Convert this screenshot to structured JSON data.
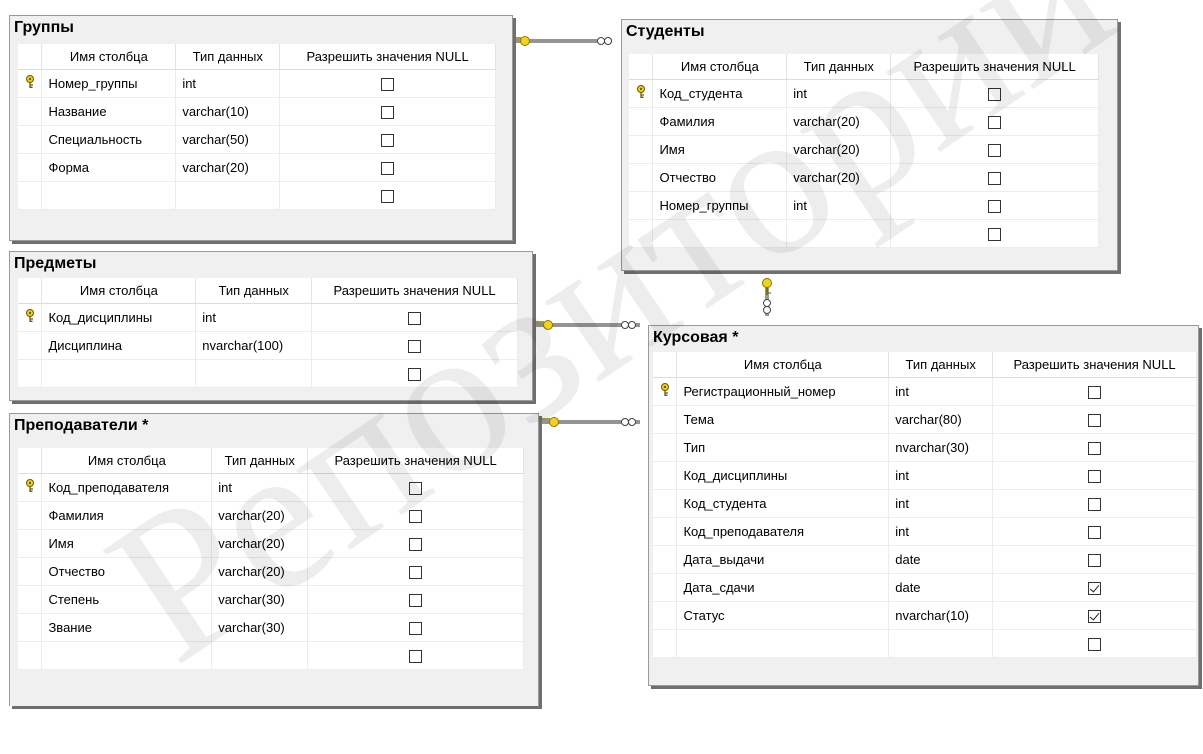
{
  "header_labels": {
    "column_name": "Имя столбца",
    "data_type": "Тип данных",
    "allow_null": "Разрешить значения NULL"
  },
  "tables": [
    {
      "title": "Группы",
      "rows": [
        {
          "pk": true,
          "name": "Номер_группы",
          "type": "int",
          "null": false
        },
        {
          "pk": false,
          "name": "Название",
          "type": "varchar(10)",
          "null": false
        },
        {
          "pk": false,
          "name": "Специальность",
          "type": "varchar(50)",
          "null": false
        },
        {
          "pk": false,
          "name": "Форма",
          "type": "varchar(20)",
          "null": false
        }
      ]
    },
    {
      "title": "Студенты",
      "rows": [
        {
          "pk": true,
          "name": "Код_студента",
          "type": "int",
          "null": false
        },
        {
          "pk": false,
          "name": "Фамилия",
          "type": "varchar(20)",
          "null": false
        },
        {
          "pk": false,
          "name": "Имя",
          "type": "varchar(20)",
          "null": false
        },
        {
          "pk": false,
          "name": "Отчество",
          "type": "varchar(20)",
          "null": false
        },
        {
          "pk": false,
          "name": "Номер_группы",
          "type": "int",
          "null": false
        }
      ]
    },
    {
      "title": "Предметы",
      "rows": [
        {
          "pk": true,
          "name": "Код_дисциплины",
          "type": "int",
          "null": false
        },
        {
          "pk": false,
          "name": "Дисциплина",
          "type": "nvarchar(100)",
          "null": false
        }
      ]
    },
    {
      "title": "Курсовая *",
      "rows": [
        {
          "pk": true,
          "name": "Регистрационный_номер",
          "type": "int",
          "null": false
        },
        {
          "pk": false,
          "name": "Тема",
          "type": "varchar(80)",
          "null": false
        },
        {
          "pk": false,
          "name": "Тип",
          "type": "nvarchar(30)",
          "null": false
        },
        {
          "pk": false,
          "name": "Код_дисциплины",
          "type": "int",
          "null": false
        },
        {
          "pk": false,
          "name": "Код_студента",
          "type": "int",
          "null": false
        },
        {
          "pk": false,
          "name": "Код_преподавателя",
          "type": "int",
          "null": false
        },
        {
          "pk": false,
          "name": "Дата_выдачи",
          "type": "date",
          "null": false
        },
        {
          "pk": false,
          "name": "Дата_сдачи",
          "type": "date",
          "null": true
        },
        {
          "pk": false,
          "name": "Статус",
          "type": "nvarchar(10)",
          "null": true
        }
      ]
    },
    {
      "title": "Преподаватели *",
      "rows": [
        {
          "pk": true,
          "name": "Код_преподавателя",
          "type": "int",
          "null": false
        },
        {
          "pk": false,
          "name": "Фамилия",
          "type": "varchar(20)",
          "null": false
        },
        {
          "pk": false,
          "name": "Имя",
          "type": "varchar(20)",
          "null": false
        },
        {
          "pk": false,
          "name": "Отчество",
          "type": "varchar(20)",
          "null": false
        },
        {
          "pk": false,
          "name": "Степень",
          "type": "varchar(30)",
          "null": false
        },
        {
          "pk": false,
          "name": "Звание",
          "type": "varchar(30)",
          "null": false
        }
      ]
    }
  ],
  "watermark": "Репозиторий",
  "colors": {
    "key_icon": "#f2d21a",
    "link_line": "#555555"
  }
}
